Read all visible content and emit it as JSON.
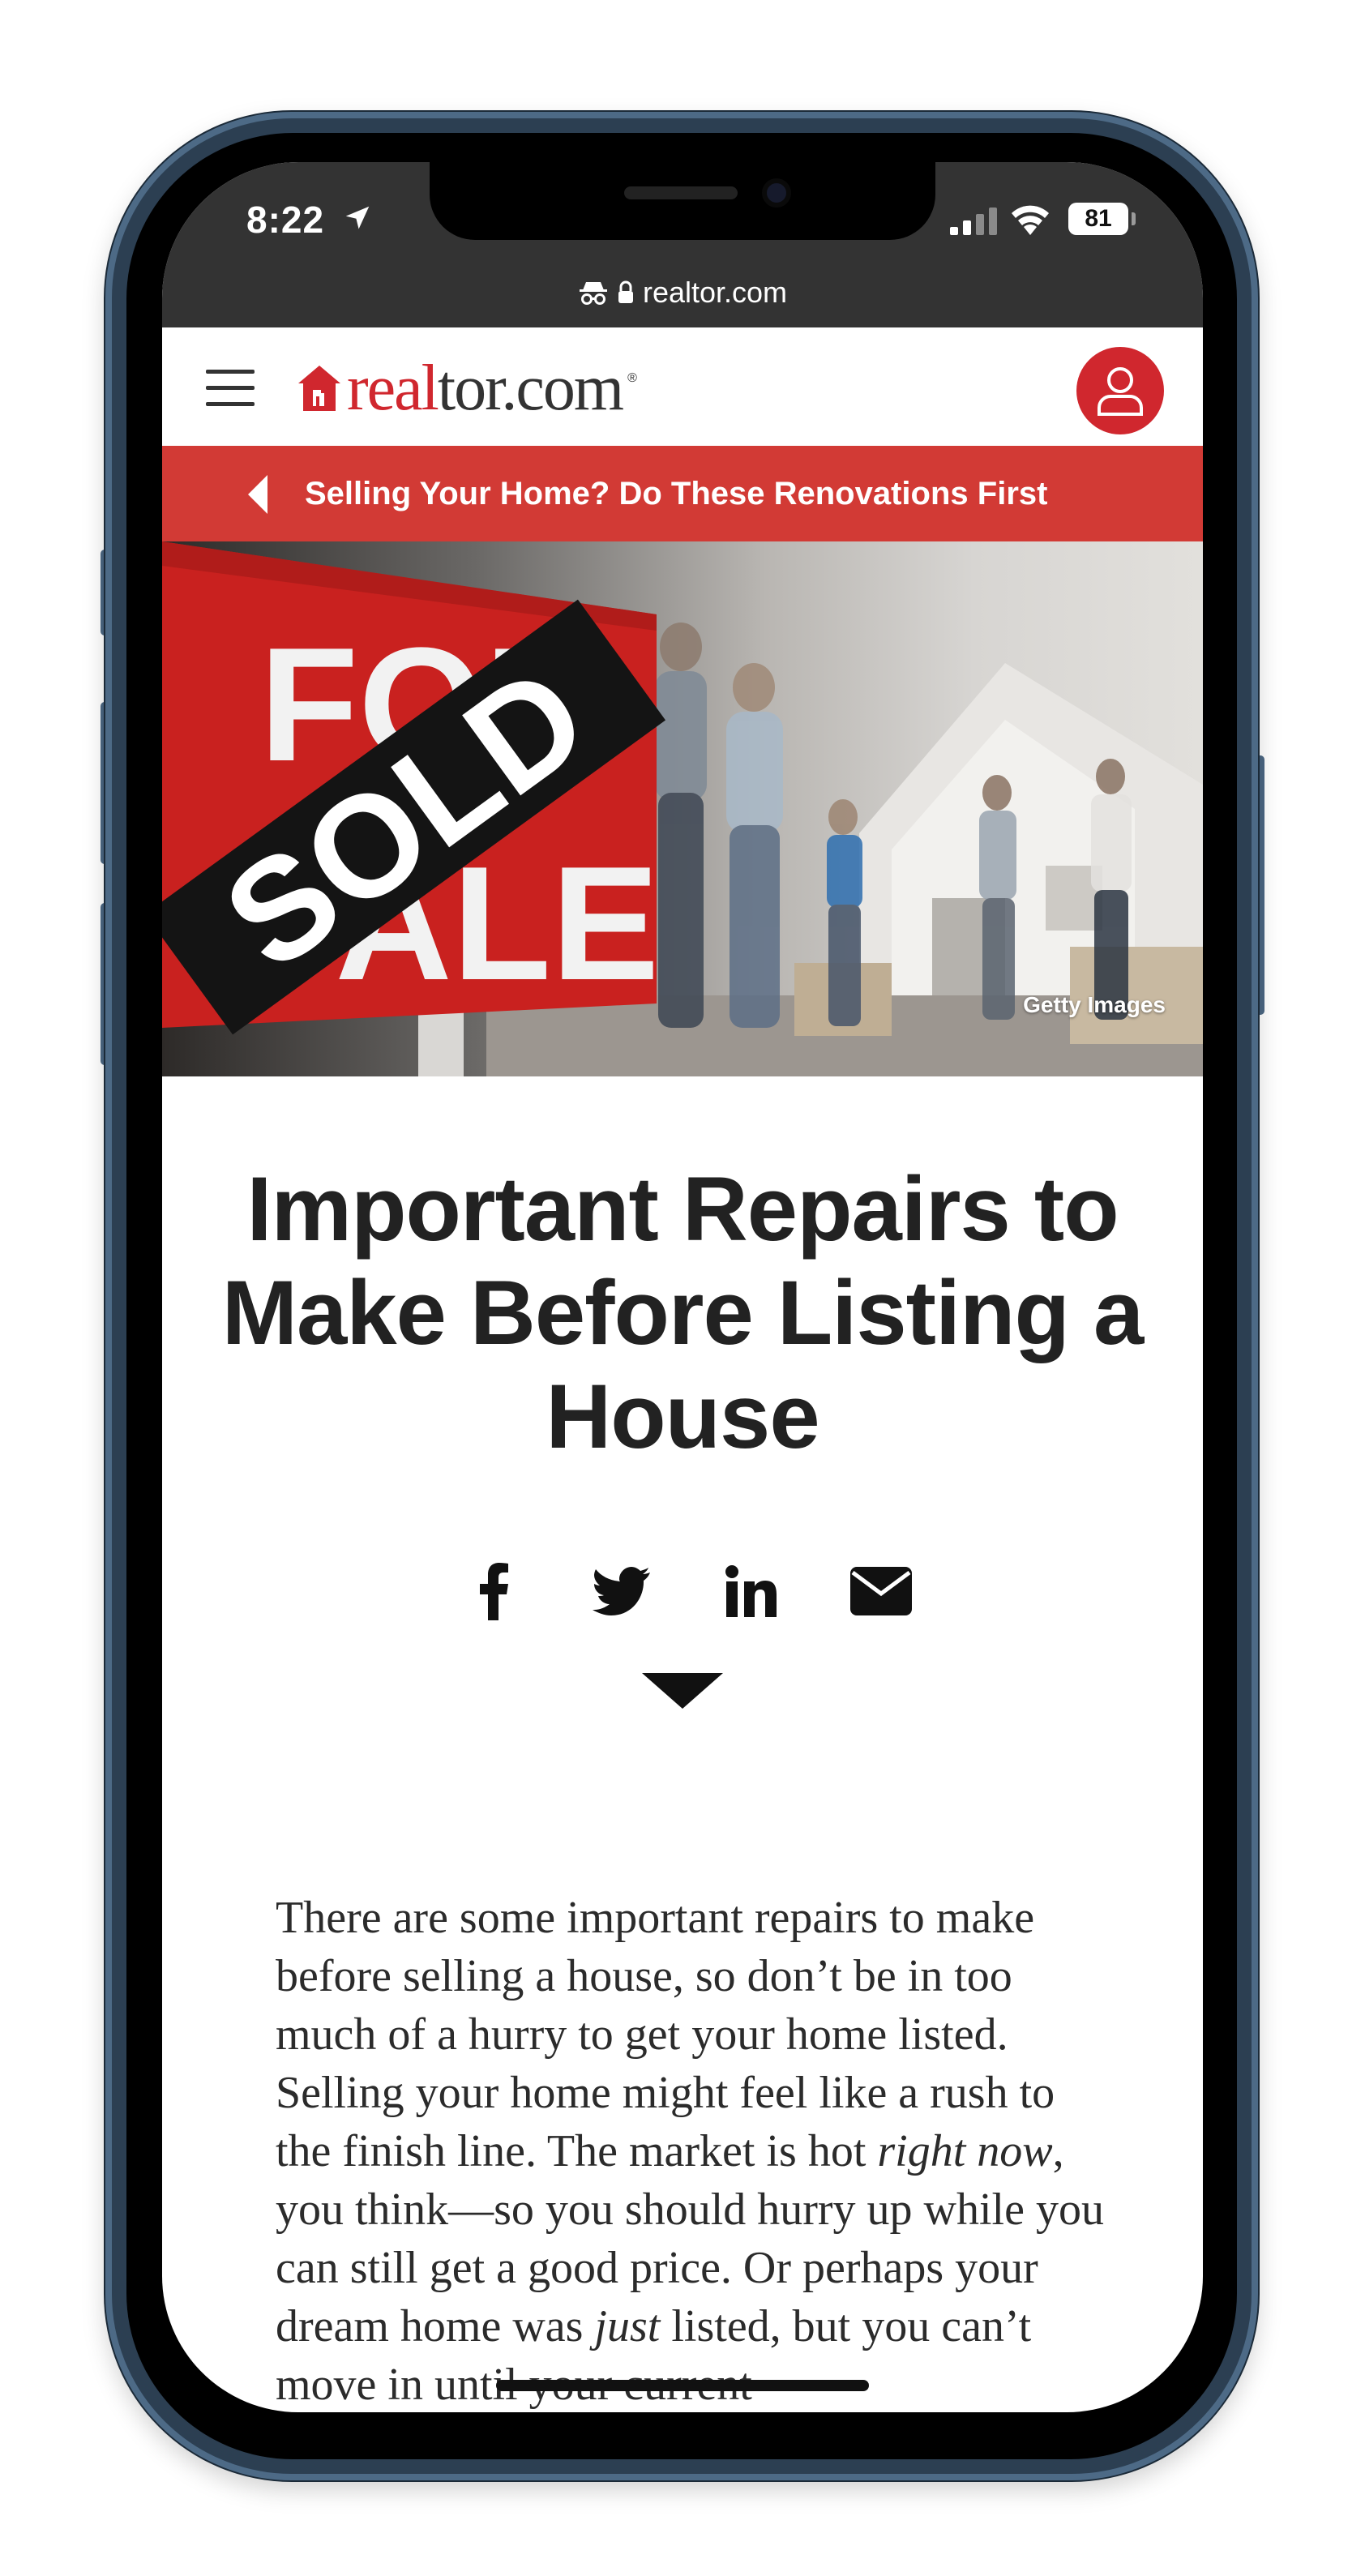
{
  "status_bar": {
    "time": "8:22",
    "battery": "81"
  },
  "browser": {
    "url": "realtor.com"
  },
  "site_header": {
    "logo_red": "real",
    "logo_dark": "tor.com",
    "logo_registered": "®"
  },
  "promo_banner": {
    "text": "Selling Your Home? Do These Renovations First"
  },
  "hero": {
    "credit": "Getty Images",
    "sign_top": "FOR",
    "sign_bottom": "SALE",
    "sold_strip": "SOLD"
  },
  "article": {
    "title": "Important Repairs to Make Before Listing a House",
    "body": {
      "p1_a": "There are some important repairs to make before selling a house, so don’t be in too much of a hurry to get your home listed. Selling your home might feel like a rush to the finish line. The market is hot ",
      "p1_em1": "right now",
      "p1_b": ", you think—so you should hurry up while you can still get a good price. Or perhaps your dream home was ",
      "p1_em2": "just",
      "p1_c": " listed, but you can’t move in until your current"
    }
  },
  "share": {
    "icons": [
      "facebook-icon",
      "twitter-icon",
      "linkedin-icon",
      "email-icon"
    ]
  },
  "colors": {
    "brand_red": "#d0272e",
    "banner_red": "#d23a35",
    "browser_chrome": "#333333",
    "title_text": "#222222"
  }
}
